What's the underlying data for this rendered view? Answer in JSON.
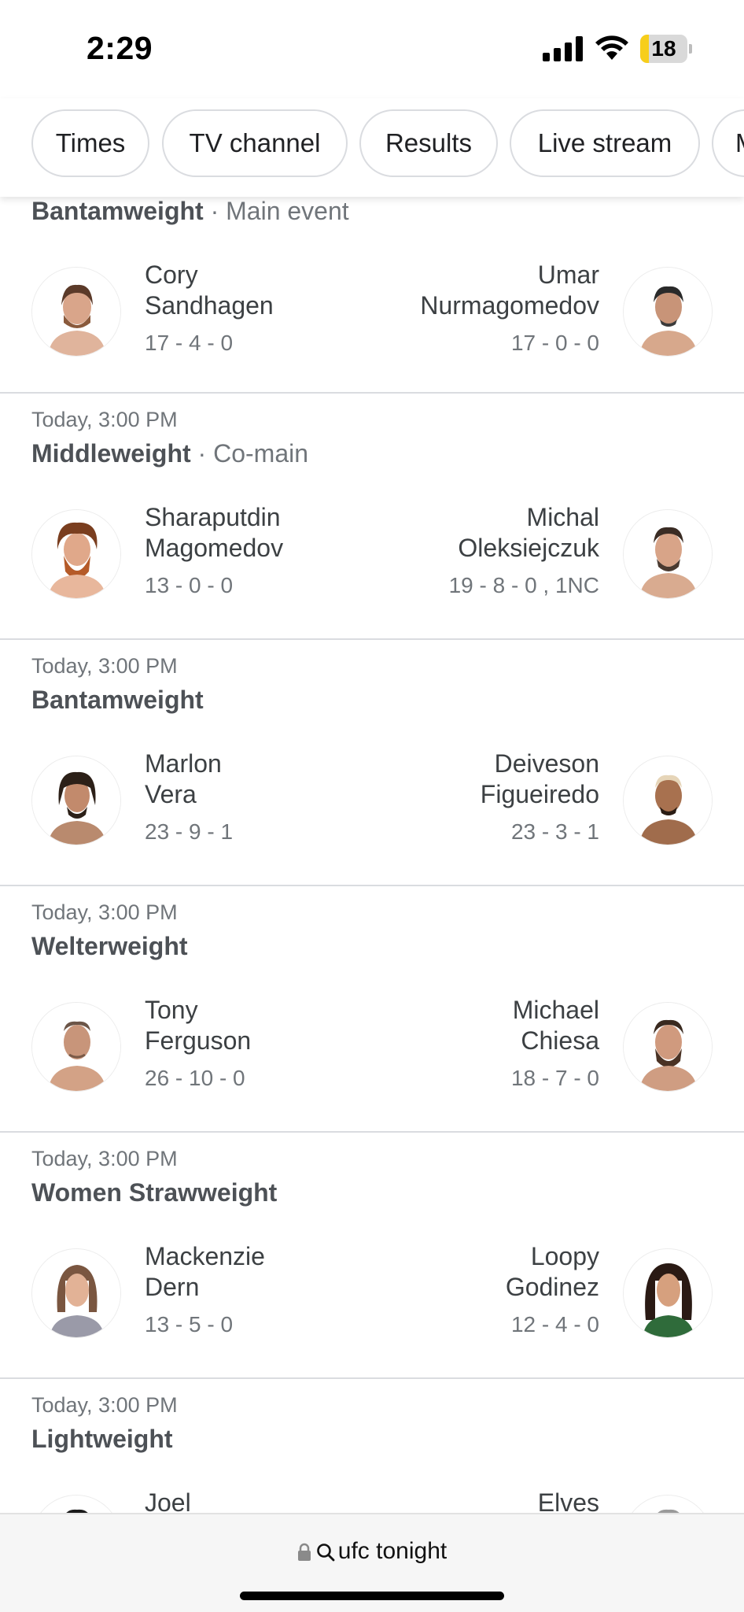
{
  "status_bar": {
    "time": "2:29",
    "battery_level": "18",
    "battery_color": "#f7ce1b",
    "battery_fraction": 0.18,
    "signal_icon": "cellular-signal-icon",
    "wifi_icon": "wifi-icon"
  },
  "chips": [
    {
      "label": "Times"
    },
    {
      "label": "TV channel"
    },
    {
      "label": "Results"
    },
    {
      "label": "Live stream"
    },
    {
      "label": "M"
    }
  ],
  "fights": [
    {
      "time": "",
      "weight": "Bantamweight",
      "sub": "Main event",
      "red": {
        "first": "Cory",
        "last": "Sandhagen",
        "record": "17 - 4 - 0"
      },
      "blue": {
        "first": "Umar",
        "last": "Nurmagomedov",
        "record": "17 - 0 - 0"
      }
    },
    {
      "time": "Today, 3:00 PM",
      "weight": "Middleweight",
      "sub": "Co-main",
      "red": {
        "first": "Sharaputdin",
        "last": "Magomedov",
        "record": "13 - 0 - 0"
      },
      "blue": {
        "first": "Michal",
        "last": "Oleksiejczuk",
        "record": "19 - 8 - 0 , 1NC"
      }
    },
    {
      "time": "Today, 3:00 PM",
      "weight": "Bantamweight",
      "sub": "",
      "red": {
        "first": "Marlon",
        "last": "Vera",
        "record": "23 - 9 - 1"
      },
      "blue": {
        "first": "Deiveson",
        "last": "Figueiredo",
        "record": "23 - 3 - 1"
      }
    },
    {
      "time": "Today, 3:00 PM",
      "weight": "Welterweight",
      "sub": "",
      "red": {
        "first": "Tony",
        "last": "Ferguson",
        "record": "26 - 10 - 0"
      },
      "blue": {
        "first": "Michael",
        "last": "Chiesa",
        "record": "18 - 7 - 0"
      }
    },
    {
      "time": "Today, 3:00 PM",
      "weight": "Women Strawweight",
      "sub": "",
      "red": {
        "first": "Mackenzie",
        "last": "Dern",
        "record": "13 - 5 - 0"
      },
      "blue": {
        "first": "Loopy",
        "last": "Godinez",
        "record": "12 - 4 - 0"
      }
    },
    {
      "time": "Today, 3:00 PM",
      "weight": "Lightweight",
      "sub": "",
      "red": {
        "first": "Joel",
        "last": "",
        "record": ""
      },
      "blue": {
        "first": "Elves",
        "last": "",
        "record": ""
      }
    }
  ],
  "address_bar": {
    "lock_icon": "lock-icon",
    "search_icon": "search-icon",
    "query": "ufc tonight"
  }
}
